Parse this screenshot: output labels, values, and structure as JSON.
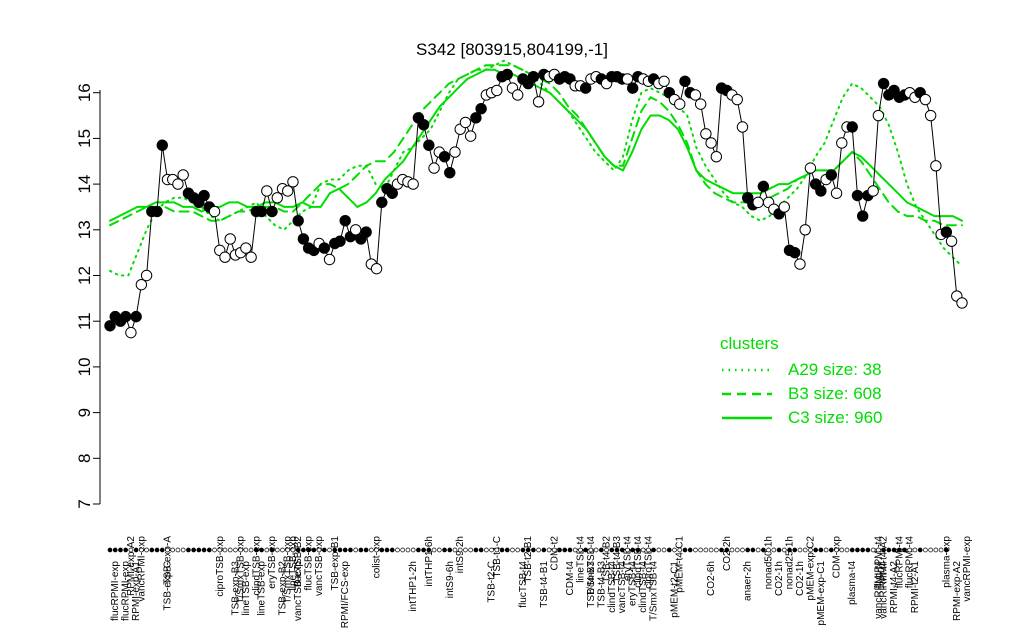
{
  "chart_data": {
    "type": "line",
    "title": "S342 [803915,804199,-1]",
    "ylim": [
      7,
      16.8
    ],
    "yticks": [
      7,
      8,
      9,
      10,
      11,
      12,
      13,
      14,
      15,
      16
    ],
    "grid": false,
    "legend_placement": "right",
    "accent_color": "#00dd00",
    "top_labels": [
      {
        "i": 4,
        "text": "RPMI-exp-A2"
      },
      {
        "i": 6,
        "text": "vancRPMI-exp"
      },
      {
        "i": 11,
        "text": "TSB-exp-A"
      },
      {
        "i": 21,
        "text": "ciproTSB-exp"
      },
      {
        "i": 25,
        "text": "T/SmxTSB-exp"
      },
      {
        "i": 28,
        "text": "clindTSB-exp"
      },
      {
        "i": 31,
        "text": "eryTSB-exp"
      },
      {
        "i": 34,
        "text": "T/SmxTSB-exp"
      },
      {
        "i": 35,
        "text": "lineTSB-exp"
      },
      {
        "i": 36,
        "text": "flucTSB-B2"
      },
      {
        "i": 38,
        "text": "flucTSB-exp"
      },
      {
        "i": 40,
        "text": "vancTSB-exp"
      },
      {
        "i": 43,
        "text": "TSB-exp-B1"
      },
      {
        "i": 51,
        "text": "colist-exp"
      },
      {
        "i": 61,
        "text": "intTHP1-6h"
      },
      {
        "i": 67,
        "text": "intS9-2h"
      },
      {
        "i": 74,
        "text": "TSB-t4-C"
      },
      {
        "i": 80,
        "text": "TSB-t2-B1"
      },
      {
        "i": 85,
        "text": "CDM-t2"
      },
      {
        "i": 90,
        "text": "lineTSB-t4"
      },
      {
        "i": 92,
        "text": "T/SmxTSB-t4"
      },
      {
        "i": 95,
        "text": "TSB-t4-B2"
      },
      {
        "i": 97,
        "text": "TSB-t4-B3"
      },
      {
        "i": 99,
        "text": "eryTSB-t4"
      },
      {
        "i": 101,
        "text": "clindTSB-t4"
      },
      {
        "i": 103,
        "text": "ciproTSB-t4"
      },
      {
        "i": 109,
        "text": "pMEM-t4-C1"
      },
      {
        "i": 118,
        "text": "CO2-2h"
      },
      {
        "i": 126,
        "text": "nonad50-1h"
      },
      {
        "i": 130,
        "text": "nonad25-1h"
      },
      {
        "i": 134,
        "text": "pMEM-exp-C2"
      },
      {
        "i": 139,
        "text": "CDM-exp"
      },
      {
        "i": 147,
        "text": "flucRPMI-t4"
      },
      {
        "i": 148,
        "text": "RPMI-t4-A2"
      },
      {
        "i": 151,
        "text": "flucRPMI-t4"
      },
      {
        "i": 153,
        "text": "flucRPMI-t4"
      },
      {
        "i": 160,
        "text": "plasma-exp"
      },
      {
        "i": 164,
        "text": "vancRPMI-exp"
      }
    ],
    "bottom_labels": [
      {
        "i": 1,
        "text": "flucRPMI-exp"
      },
      {
        "i": 3,
        "text": "flucRPMI-exp"
      },
      {
        "i": 5,
        "text": "RPMI-exp-A1"
      },
      {
        "i": 11,
        "text": "TSB-exp-C"
      },
      {
        "i": 24,
        "text": "TSB-exp-B3"
      },
      {
        "i": 26,
        "text": "lineTSB-exp"
      },
      {
        "i": 29,
        "text": "lineTSB-exp"
      },
      {
        "i": 33,
        "text": "TSB-exp-B2"
      },
      {
        "i": 36,
        "text": "vancTSB-exp"
      },
      {
        "i": 45,
        "text": "RPMI/FCS-exp"
      },
      {
        "i": 58,
        "text": "intTHP1-2h"
      },
      {
        "i": 65,
        "text": "intS9-6h"
      },
      {
        "i": 73,
        "text": "TSB-t2-C"
      },
      {
        "i": 79,
        "text": "flucTSB-t4"
      },
      {
        "i": 83,
        "text": "TSB-t4-B1"
      },
      {
        "i": 88,
        "text": "CDM-t4"
      },
      {
        "i": 92,
        "text": "TSB-t4-B3"
      },
      {
        "i": 94,
        "text": "TSB-t4-B3"
      },
      {
        "i": 96,
        "text": "clindTSB-t4"
      },
      {
        "i": 98,
        "text": "vancTSB-t4"
      },
      {
        "i": 100,
        "text": "eryTSB-t4"
      },
      {
        "i": 102,
        "text": "clindTSB-t4"
      },
      {
        "i": 104,
        "text": "T/SmxTSB-t4"
      },
      {
        "i": 108,
        "text": "pMEM-t2-C1"
      },
      {
        "i": 115,
        "text": "CO2-6h"
      },
      {
        "i": 122,
        "text": "anaer-2h"
      },
      {
        "i": 128,
        "text": "CO2-1h"
      },
      {
        "i": 132,
        "text": "CO2-1h"
      },
      {
        "i": 136,
        "text": "pMEM-exp-C1"
      },
      {
        "i": 142,
        "text": "plasma-t4"
      },
      {
        "i": 147,
        "text": "vancRPMI-t4"
      },
      {
        "i": 148,
        "text": "vancRPMI-t4"
      },
      {
        "i": 150,
        "text": "RPMI-t4-A2"
      },
      {
        "i": 154,
        "text": "RPMI-t2-A1"
      },
      {
        "i": 162,
        "text": "RPMI-exp-A2"
      }
    ],
    "sample_values": [
      10.9,
      11.1,
      11.0,
      11.1,
      10.75,
      11.1,
      11.8,
      12.0,
      13.4,
      13.4,
      14.85,
      14.1,
      14.1,
      14.0,
      14.2,
      13.8,
      13.7,
      13.6,
      13.75,
      13.5,
      13.4,
      12.55,
      12.4,
      12.8,
      12.45,
      12.5,
      12.6,
      12.4,
      13.4,
      13.4,
      13.85,
      13.4,
      13.7,
      13.9,
      13.85,
      14.05,
      13.2,
      12.8,
      12.6,
      12.55,
      12.7,
      12.6,
      12.35,
      12.7,
      12.75,
      13.2,
      12.85,
      13.0,
      12.8,
      12.95,
      12.25,
      12.15,
      13.6,
      13.9,
      13.8,
      14.0,
      14.1,
      14.05,
      14.0,
      15.45,
      15.3,
      14.85,
      14.35,
      14.7,
      14.6,
      14.25,
      14.7,
      15.2,
      15.35,
      15.05,
      15.45,
      15.65,
      15.95,
      16.0,
      16.05,
      16.35,
      16.4,
      16.1,
      15.95,
      16.3,
      16.2,
      16.35,
      15.8,
      16.4,
      16.35,
      16.4,
      16.3,
      16.35,
      16.3,
      16.15,
      16.15,
      16.1,
      16.3,
      16.35,
      16.3,
      16.2,
      16.35,
      16.35,
      16.3,
      16.3,
      16.1,
      16.35,
      16.3,
      16.25,
      16.3,
      16.2,
      16.25,
      16.0,
      15.85,
      15.75,
      16.25,
      16.0,
      15.95,
      15.75,
      15.1,
      14.9,
      14.6,
      16.1,
      16.05,
      15.95,
      15.85,
      15.25,
      13.7,
      13.55,
      13.6,
      13.95,
      13.6,
      13.45,
      13.35,
      13.5,
      12.55,
      12.5,
      12.25,
      13.0,
      14.35,
      14.0,
      13.85,
      14.1,
      14.2,
      13.8,
      14.9,
      15.25,
      15.25,
      13.75,
      13.3,
      13.75,
      13.85,
      15.5,
      16.2,
      15.95,
      16.05,
      15.9,
      15.95,
      16.0,
      15.9,
      16.0,
      15.85,
      15.5,
      14.4,
      12.9,
      12.95,
      12.75,
      11.55,
      11.4
    ],
    "sample_fill": [
      1,
      1,
      1,
      1,
      0,
      1,
      0,
      0,
      1,
      1,
      1,
      0,
      0,
      0,
      0,
      1,
      1,
      1,
      1,
      1,
      0,
      0,
      0,
      0,
      0,
      0,
      0,
      0,
      1,
      1,
      0,
      1,
      0,
      0,
      0,
      0,
      1,
      1,
      1,
      1,
      0,
      1,
      0,
      1,
      1,
      1,
      1,
      0,
      1,
      1,
      0,
      0,
      1,
      1,
      1,
      0,
      0,
      0,
      0,
      1,
      1,
      1,
      0,
      0,
      1,
      1,
      0,
      0,
      0,
      0,
      1,
      1,
      0,
      0,
      0,
      1,
      1,
      0,
      0,
      1,
      1,
      1,
      0,
      1,
      0,
      0,
      1,
      1,
      1,
      0,
      0,
      1,
      0,
      0,
      1,
      0,
      1,
      1,
      1,
      0,
      1,
      1,
      0,
      0,
      1,
      0,
      0,
      1,
      0,
      0,
      1,
      1,
      0,
      0,
      0,
      0,
      0,
      1,
      1,
      0,
      0,
      0,
      1,
      1,
      0,
      1,
      0,
      0,
      1,
      0,
      1,
      1,
      0,
      0,
      0,
      1,
      1,
      0,
      1,
      0,
      0,
      0,
      1,
      1,
      1,
      1,
      0,
      0,
      1,
      1,
      1,
      1,
      1,
      0,
      0,
      1,
      0,
      0,
      0,
      0,
      1
    ],
    "series": [
      {
        "name": "A29 size: 38",
        "dash": "dotted",
        "values": [
          12.1,
          12.0,
          12.0,
          12.5,
          13.0,
          13.4,
          13.6,
          13.7,
          13.7,
          13.6,
          13.5,
          13.3,
          13.2,
          13.3,
          13.4,
          13.5,
          13.6,
          13.3,
          13.1,
          13.0,
          13.2,
          13.4,
          13.5,
          14.0,
          14.1,
          14.1,
          14.3,
          14.4,
          14.4,
          14.0,
          13.9,
          14.3,
          14.7,
          14.8,
          15.0,
          15.2,
          15.6,
          16.0,
          16.3,
          16.4,
          16.5,
          16.5,
          16.6,
          16.7,
          16.6,
          16.5,
          16.4,
          16.2,
          16.0,
          15.8,
          15.6,
          15.3,
          15.0,
          14.7,
          14.5,
          14.3,
          14.6,
          15.4,
          16.0,
          16.1,
          16.0,
          15.9,
          15.7,
          15.5,
          14.8,
          14.4,
          14.1,
          13.8,
          13.6,
          13.5,
          13.3,
          13.2,
          13.3,
          13.5,
          13.7,
          13.9,
          14.2,
          14.6,
          14.9,
          15.4,
          15.9,
          16.2,
          16.1,
          15.9,
          15.7,
          15.3,
          14.7,
          14.0,
          13.5,
          13.2,
          12.9,
          12.6,
          12.4,
          12.2
        ]
      },
      {
        "name": "B3 size: 608",
        "dash": "dashed",
        "values": [
          13.1,
          13.2,
          13.3,
          13.4,
          13.5,
          13.5,
          13.5,
          13.4,
          13.4,
          13.4,
          13.3,
          13.2,
          13.2,
          13.3,
          13.4,
          13.4,
          13.5,
          13.5,
          13.5,
          13.4,
          13.4,
          13.6,
          13.8,
          14.0,
          14.0,
          13.9,
          14.0,
          14.2,
          14.4,
          14.5,
          14.5,
          14.7,
          15.0,
          15.3,
          15.6,
          15.8,
          16.0,
          16.2,
          16.3,
          16.4,
          16.5,
          16.6,
          16.6,
          16.6,
          16.6,
          16.5,
          16.4,
          16.3,
          16.2,
          16.0,
          15.7,
          15.5,
          15.2,
          14.9,
          14.6,
          14.4,
          14.4,
          15.0,
          15.6,
          15.9,
          15.8,
          15.6,
          15.3,
          14.9,
          14.3,
          14.0,
          13.8,
          13.7,
          13.6,
          13.6,
          13.6,
          13.6,
          13.7,
          13.8,
          13.9,
          14.1,
          14.2,
          14.3,
          14.3,
          14.3,
          14.5,
          14.7,
          14.5,
          14.2,
          13.9,
          13.6,
          13.4,
          13.3,
          13.3,
          13.2,
          13.2,
          13.1,
          13.1,
          13.1
        ]
      },
      {
        "name": "C3 size: 960",
        "dash": "solid",
        "values": [
          13.2,
          13.3,
          13.4,
          13.5,
          13.5,
          13.6,
          13.6,
          13.6,
          13.5,
          13.5,
          13.4,
          13.5,
          13.5,
          13.6,
          13.6,
          13.5,
          13.5,
          13.6,
          13.6,
          13.5,
          13.5,
          13.6,
          13.5,
          13.5,
          13.8,
          13.9,
          13.7,
          13.5,
          13.6,
          13.8,
          14.1,
          14.3,
          14.5,
          14.8,
          15.1,
          15.4,
          15.7,
          15.9,
          16.1,
          16.3,
          16.4,
          16.5,
          16.5,
          16.4,
          16.4,
          16.3,
          16.2,
          16.1,
          16.0,
          15.8,
          15.6,
          15.4,
          15.2,
          14.9,
          14.6,
          14.4,
          14.3,
          14.7,
          15.2,
          15.5,
          15.5,
          15.4,
          15.2,
          14.8,
          14.3,
          14.1,
          14.0,
          13.9,
          13.8,
          13.8,
          13.8,
          13.8,
          13.9,
          14.0,
          14.0,
          14.1,
          14.2,
          14.3,
          14.3,
          14.3,
          14.5,
          14.7,
          14.6,
          14.4,
          14.2,
          14.0,
          13.8,
          13.6,
          13.5,
          13.4,
          13.3,
          13.3,
          13.3,
          13.2
        ]
      }
    ],
    "legend": {
      "title": "clusters"
    }
  }
}
